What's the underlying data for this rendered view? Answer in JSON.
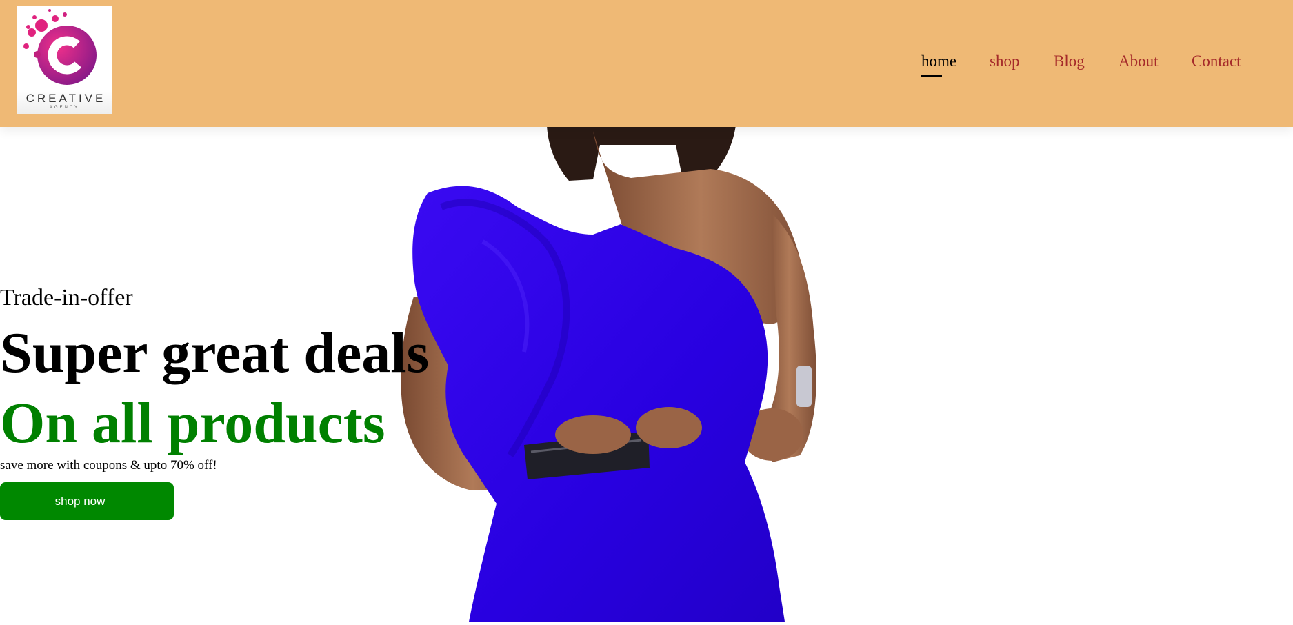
{
  "brand": {
    "logo_word": "CREATIVE",
    "logo_sub": "AGENCY",
    "logo_icon": "c-letter-logo",
    "colors": {
      "pink": "#E0237E",
      "purple": "#9A1A8C"
    }
  },
  "nav": {
    "items": [
      {
        "label": "home",
        "active": true
      },
      {
        "label": "shop",
        "active": false
      },
      {
        "label": "Blog",
        "active": false
      },
      {
        "label": "About",
        "active": false
      },
      {
        "label": "Contact",
        "active": false
      }
    ]
  },
  "hero": {
    "tag": "Trade-in-offer",
    "headline": "Super great deals",
    "subheadline": "On all products",
    "description": "save more with coupons & upto 70% off!",
    "button_label": "shop now",
    "image": "model-blue-dress"
  },
  "colors": {
    "header_bg": "#EFB975",
    "nav_link": "#A52A2A",
    "nav_active": "#000000",
    "accent_green": "#008000",
    "button_bg": "#008800",
    "dress_blue": "#2A00E6"
  }
}
